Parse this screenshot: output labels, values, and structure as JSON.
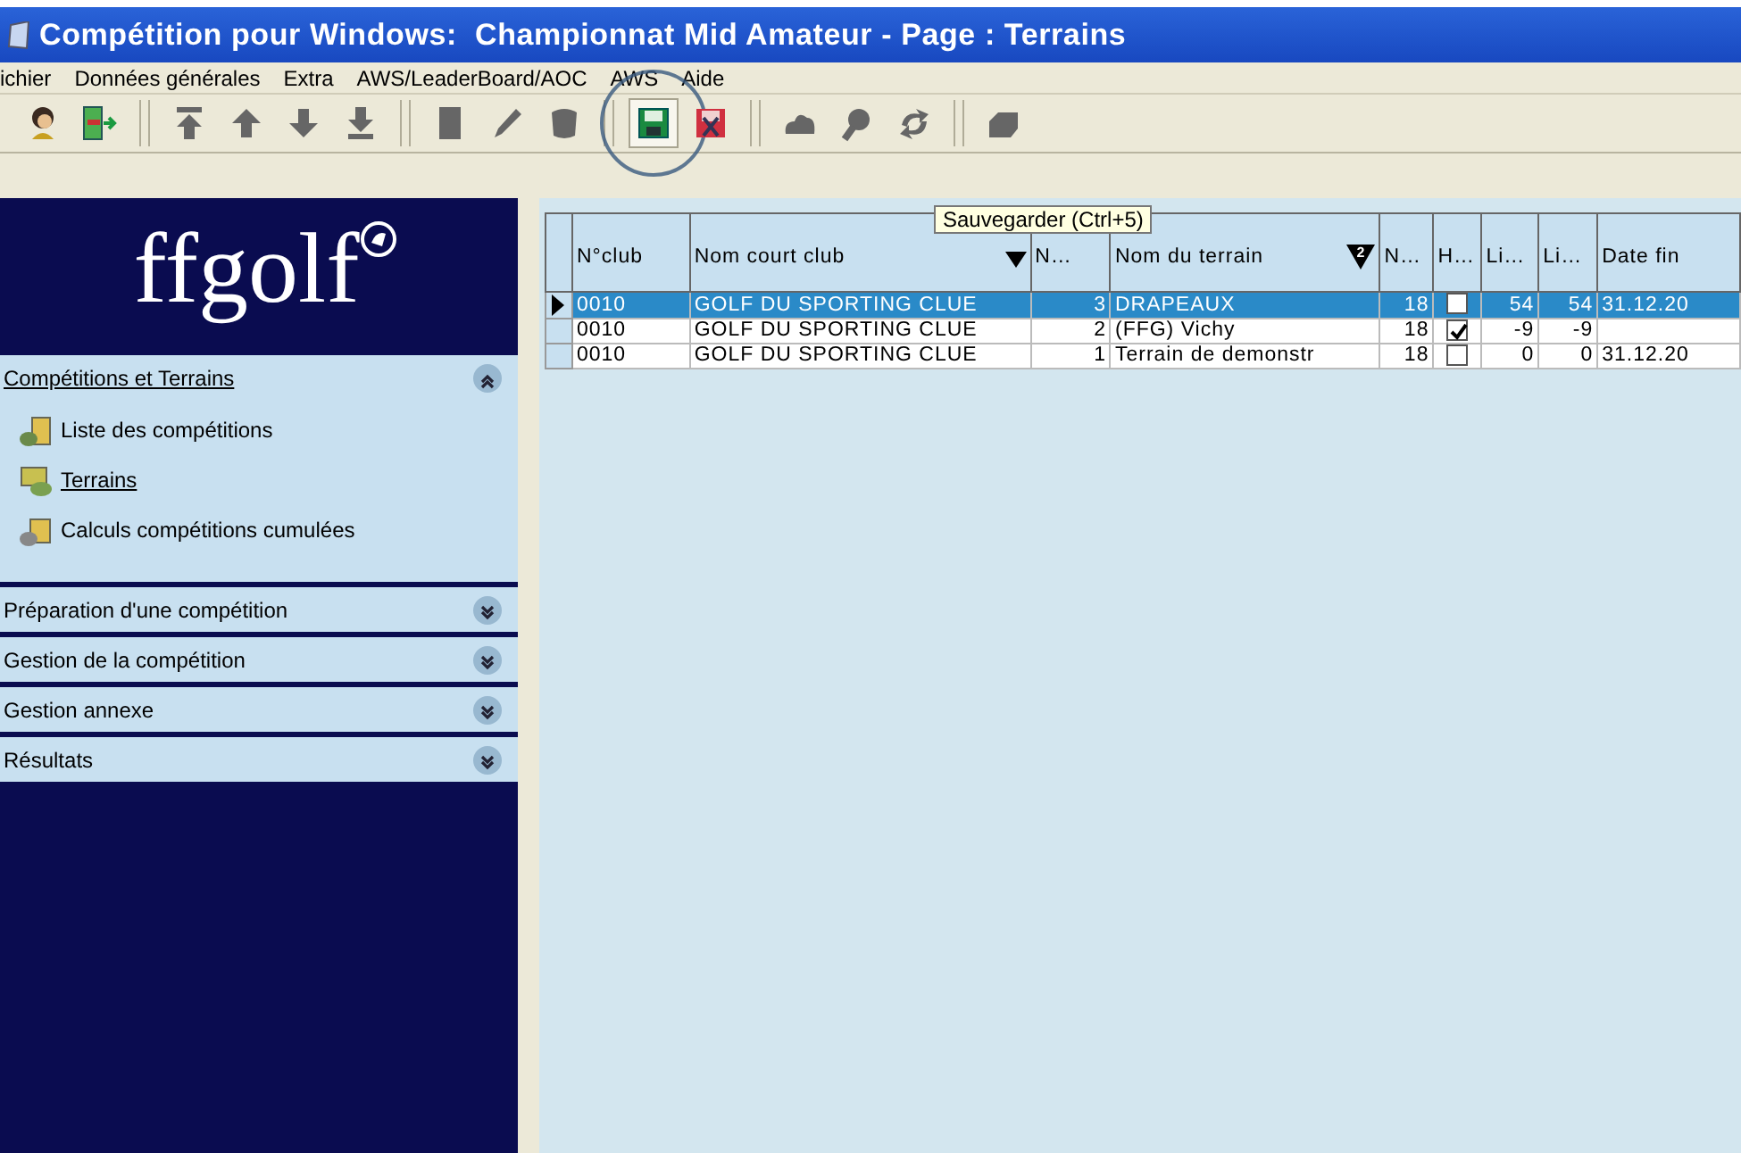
{
  "window": {
    "title": "Compétition pour Windows:  Championnat Mid Amateur - Page : Terrains"
  },
  "menu": [
    "ichier",
    "Données générales",
    "Extra",
    "AWS/LeaderBoard/AOC",
    "AWS",
    "Aide"
  ],
  "toolbar": {
    "groups": [
      {
        "buttons": [
          {
            "circled": false
          },
          {
            "circled": false
          }
        ]
      },
      {
        "buttons": [
          {
            "circled": false
          },
          {
            "circled": false
          },
          {
            "circled": false
          },
          {
            "circled": false
          }
        ]
      },
      {
        "buttons": [
          {
            "circled": false
          },
          {
            "circled": false
          },
          {
            "circled": false
          }
        ]
      },
      {
        "buttons": [
          {
            "circled": true
          },
          {
            "circled": false
          }
        ]
      },
      {
        "buttons": [
          {
            "circled": false
          },
          {
            "circled": false
          },
          {
            "circled": false
          }
        ]
      },
      {
        "buttons": [
          {
            "circled": false
          }
        ]
      }
    ],
    "tooltip": "Sauvegarder (Ctrl+5)"
  },
  "sidebar": {
    "logo": "ffgolf",
    "sections": [
      {
        "label": "Compétitions et Terrains",
        "expanded": true,
        "items": [
          {
            "label": "Liste des compétitions",
            "selected": false
          },
          {
            "label": "Terrains",
            "selected": true
          },
          {
            "label": "Calculs compétitions cumulées",
            "selected": false
          }
        ]
      },
      {
        "label": "Préparation d'une compétition",
        "expanded": false
      },
      {
        "label": "Gestion de la compétition",
        "expanded": false
      },
      {
        "label": "Gestion annexe",
        "expanded": false
      },
      {
        "label": "Résultats",
        "expanded": false
      }
    ]
  },
  "table": {
    "columns": [
      {
        "label": "N°club",
        "sorted": false
      },
      {
        "label": "Nom court club",
        "sorted": true
      },
      {
        "label": "N…",
        "sorted": false
      },
      {
        "label": "Nom du terrain",
        "sorted": true,
        "sort_order": "2"
      },
      {
        "label": "N…",
        "sorted": false
      },
      {
        "label": "H…",
        "sorted": false,
        "kind": "check"
      },
      {
        "label": "Li…",
        "sorted": false
      },
      {
        "label": "Li…",
        "sorted": false
      },
      {
        "label": "Date fin",
        "sorted": false
      }
    ],
    "rows": [
      {
        "selected": true,
        "cells": [
          "0010",
          "GOLF DU SPORTING CLUE",
          "3",
          "DRAPEAUX",
          "18",
          false,
          "54",
          "54",
          "31.12.20"
        ]
      },
      {
        "selected": false,
        "cells": [
          "0010",
          "GOLF DU SPORTING CLUE",
          "2",
          "(FFG) Vichy",
          "18",
          true,
          "-9",
          "-9",
          ""
        ]
      },
      {
        "selected": false,
        "cells": [
          "0010",
          "GOLF DU SPORTING CLUE",
          "1",
          "Terrain de demonstr",
          "18",
          false,
          "0",
          "0",
          "31.12.20"
        ]
      }
    ]
  }
}
